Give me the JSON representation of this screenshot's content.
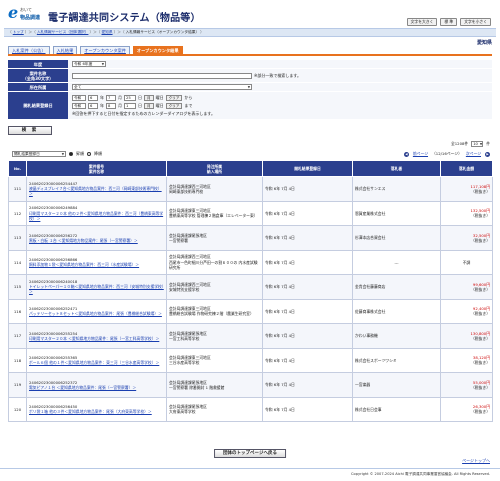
{
  "header": {
    "logo_mark": "e",
    "logo_top": "おいて",
    "logo_bottom": "物品調達",
    "system_title": "電子調達共同システム（物品等）",
    "size_buttons": [
      "文字を大きく",
      "標 準",
      "文字を小さく"
    ]
  },
  "breadcrumb": [
    "トップ",
    "入札情報サービス（団体選択）",
    "愛知県",
    "入札情報サービス（オープンカウンタ結果）"
  ],
  "prefecture": "愛知県",
  "tabs": [
    {
      "label": "入札案件（公告）",
      "active": false
    },
    {
      "label": "入札結果",
      "active": false
    },
    {
      "label": "オープンカウンタ案件",
      "active": false
    },
    {
      "label": "オープンカウンタ結果",
      "active": true
    }
  ],
  "form": {
    "year_label": "年度",
    "year_value": "令和 6年度",
    "name_label": "案件名称",
    "name_sub": "（全角30文字）",
    "name_value": "",
    "name_note": "※部分一致で検索します。",
    "place_label": "所在所属",
    "place_value": "全て",
    "date_label": "開札結果登録日",
    "era": "令和",
    "from_year": "6",
    "from_year_unit": "年",
    "from_month": "7",
    "from_month_unit": "月",
    "from_day": "25",
    "from_day_unit": "日",
    "cal_btn": "月",
    "wd": "曜日",
    "clear_btn": "クリア",
    "from_suffix": "から",
    "to_year": "6",
    "to_month": "8",
    "to_day": "1",
    "to_suffix": "まで",
    "date_note": "※回答を押下すると日付を指定するためのカレンダーダイアログを表示します。",
    "search_btn": "検 索"
  },
  "results": {
    "sort_value": "開札結果登録日",
    "sort_asc": "昇順",
    "sort_desc": "降順",
    "count_text": "全1208件",
    "per_page": "10",
    "per_page_unit": "件",
    "prev": "前ページ",
    "page_info": "（12/16ページ）",
    "next": "次ページ",
    "columns": [
      "No.",
      "案件番号\n案件名称",
      "発注所属\n納入場所",
      "開札結果登録日",
      "落札者",
      "落札金額"
    ],
    "rows": [
      {
        "no": "111",
        "id": "24062023000006254447",
        "name": "液晶ディスプレイ７台＜愛知県地方物品案件：西三河（岡崎東部技術専門校）＞",
        "dept": "会計局調達課西三河地区",
        "place": "岡崎東部技術専門校",
        "date": "令和 6年 7月 4日",
        "winner": "株式会社サンエス",
        "amount": "117,108円",
        "tax": "（税抜き）"
      },
      {
        "no": "112",
        "id": "24062023000006249884",
        "name": "印刷用マスター２０本 他の２件＜愛知県地方物品案件：西三河（豊橋東高等学校）＞",
        "dept": "会計局調達課東三河地区",
        "place": "豊橋東高等学校 管理棟２階倉庫（エレベーター東）",
        "date": "令和 6年 7月 4日",
        "winner": "恩賀産業株式会社",
        "amount": "132,500円",
        "tax": "（税抜き）"
      },
      {
        "no": "113",
        "id": "24062023000006256272",
        "name": "黒板・白板 １台 ＜愛知県地方物品案件：尾張（一宮警察署）＞",
        "dept": "会計局調達課尾張地区",
        "place": "一宮警察署",
        "date": "令和 6年 7月 4日",
        "winner": "杉澤本店合資会社",
        "amount": "32,500円",
        "tax": "（税抜き）"
      },
      {
        "no": "114",
        "id": "24062023000006256866",
        "name": "飼料添加物１袋＜愛知県地方物品案件：西三河（水産試験場）＞",
        "dept": "会計局調達課西三河地区",
        "place": "西尾市一色町細川分芦田一の割６００の 内水産試験研究所",
        "date": "令和 6年 7月 4日",
        "winner": "---",
        "amount": "不調",
        "tax": ""
      },
      {
        "no": "115",
        "id": "24062023000006240018",
        "name": "トイレットペーパー１０箱＜愛知県地方物品案件：西三河（安城特別支援学校）＞",
        "dept": "会計局調達課西三河地区",
        "place": "安城特別支援学校",
        "date": "令和 6年 7月 4日",
        "winner": "金貴会社藤藤商店",
        "amount": "99,600円",
        "tax": "（税抜き）"
      },
      {
        "no": "116",
        "id": "24062023000006252471",
        "name": "パッテリーセット８セット＜愛知県地方物品案件：尾張（豊橋総合試験場）＞",
        "dept": "会計局調達課東三河地区",
        "place": "豊橋総合試験場 作物研究棟２階（農業生研究室）",
        "date": "令和 6年 7月 4日",
        "winner": "佐藤商事株式会社",
        "amount": "92,400円",
        "tax": "（税抜き）"
      },
      {
        "no": "117",
        "id": "24062023000006255254",
        "name": "印刷用マスター２０本 ＜愛知県地方物品案件：尾張（一宮工科高等学校）＞",
        "dept": "会計局調達課尾張地区",
        "place": "一宮工科高等学校",
        "date": "令和 6年 7月 4日",
        "winner": "かわい事務機",
        "amount": "130,800円",
        "tax": "（税抜き）"
      },
      {
        "no": "118",
        "id": "24062023000006255365",
        "name": "ボール６個 他の１件＜愛知県地方物品案件：東三河（三谷水産高等学校）＞",
        "dept": "会計局調達課東三河地区",
        "place": "三谷水産高等学校",
        "date": "令和 6年 7月 4日",
        "winner": "株式会社スポーツワシミ",
        "amount": "38,120円",
        "tax": "（税抜き）"
      },
      {
        "no": "119",
        "id": "24062023000006252372",
        "name": "電気ピアノ１台 ＜愛知県地方物品案件：尾張（一宮警察署）＞",
        "dept": "会計局調達課尾張地区",
        "place": "一宮警察署 除番開封 1 階救援館",
        "date": "令和 6年 7月 4日",
        "winner": "一宮楽器",
        "amount": "55,000円",
        "tax": "（税抜き）"
      },
      {
        "no": "120",
        "id": "24062023000006256450",
        "name": "ポリ袋１箱 他の３件＜愛知県地方物品案件：尾張（大府東高等学校）＞",
        "dept": "会計局調達課尾張地区",
        "place": "大府東高等学校",
        "date": "令和 6年 7月 4日",
        "winner": "株式会社日会事",
        "amount": "26,300円",
        "tax": "（税抜き）"
      }
    ]
  },
  "bottom_button": "団体のトップページへ戻る",
  "page_top": "ページトップへ",
  "footer": "Copyright © 2007-2024 Aichi 電子調達共同事業運営協議会. All Rights Reserved."
}
